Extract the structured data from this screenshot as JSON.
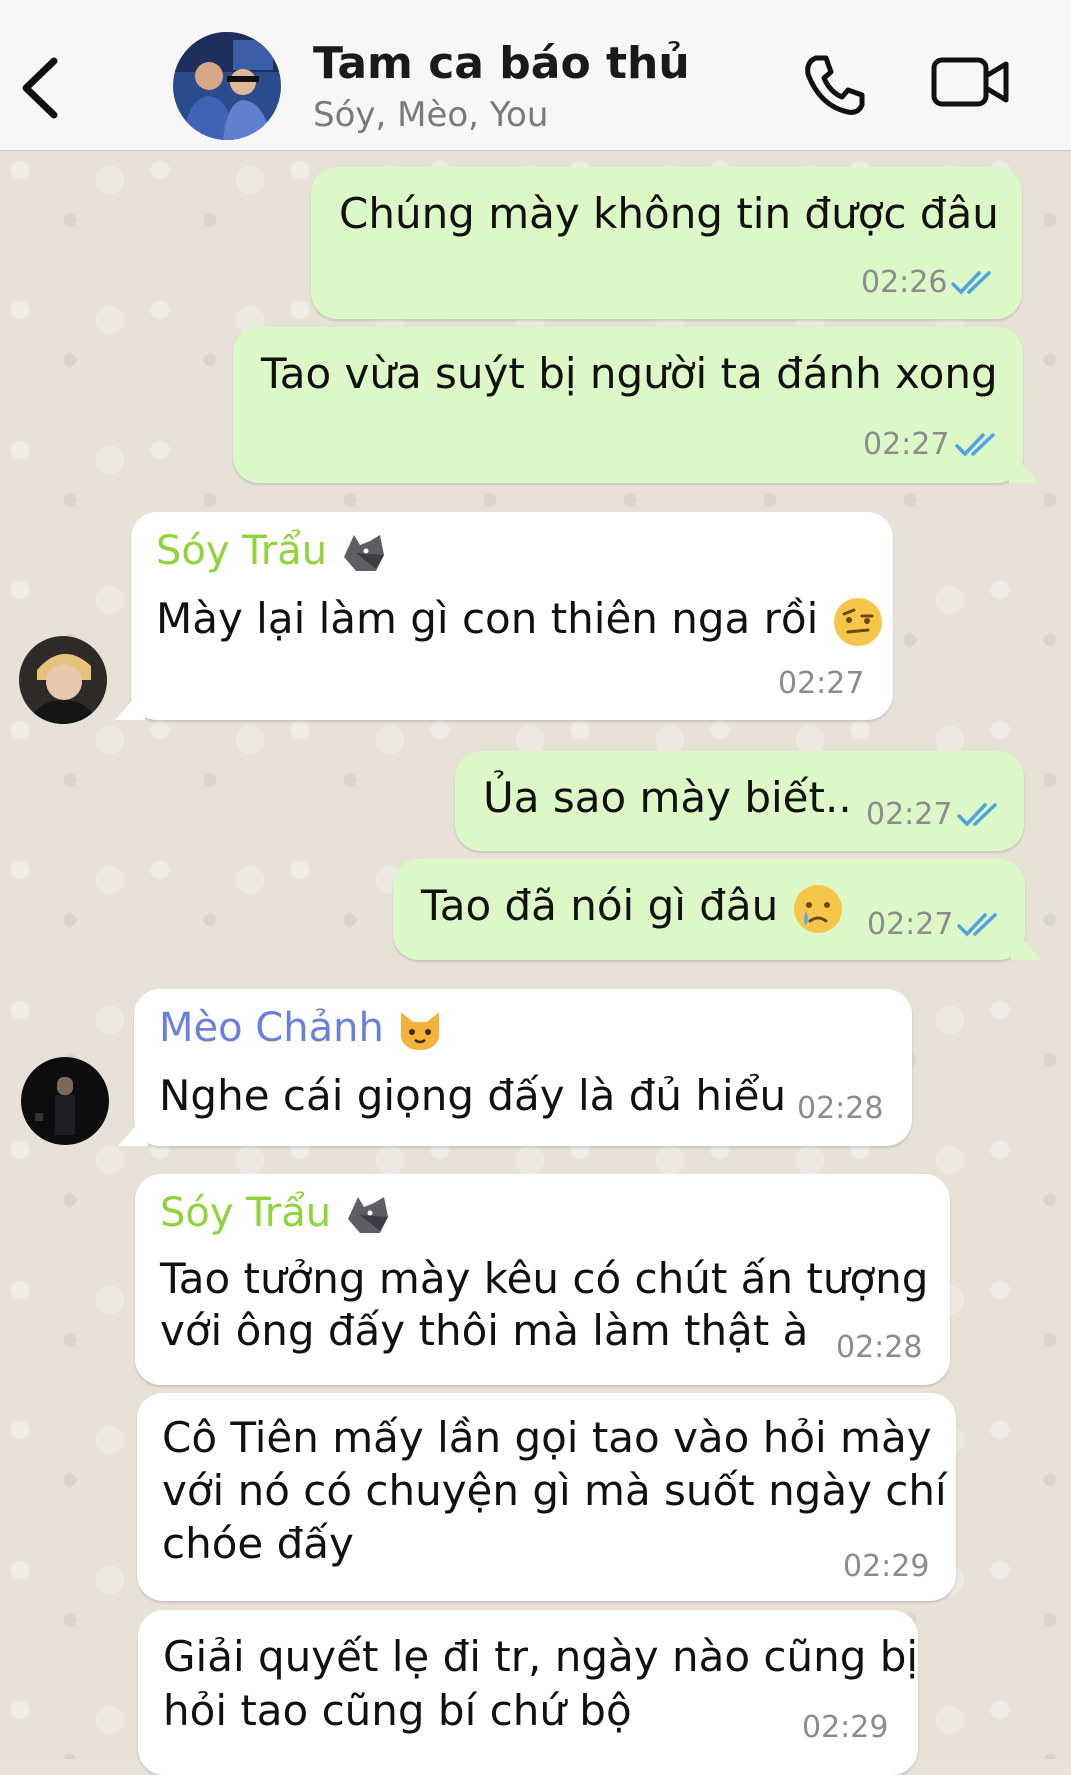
{
  "header": {
    "title": "Tam ca báo thủ",
    "subtitle": "Sóy, Mèo, You",
    "icons": {
      "back": "chevron-left-icon",
      "call": "phone-icon",
      "video": "video-camera-icon"
    }
  },
  "colors": {
    "outgoing_bubble": "#dcf8c6",
    "incoming_bubble": "#ffffff",
    "chat_background": "#e7e1d8",
    "read_ticks": "#4fa3e0",
    "sender_soy": "#8fd43b",
    "sender_meo": "#6b7fe0"
  },
  "messages": [
    {
      "direction": "out",
      "text": "Chúng mày không tin được đâu",
      "time": "02:26",
      "status": "read"
    },
    {
      "direction": "out",
      "text": "Tao vừa suýt bị người ta đánh xong",
      "time": "02:27",
      "status": "read"
    },
    {
      "direction": "in",
      "sender": "Sóy Trẩu",
      "sender_emoji": "wolf-emoji",
      "text": "Mày lại làm gì con thiên nga rồi",
      "text_emoji": "raised-eyebrow-face-emoji",
      "time": "02:27"
    },
    {
      "direction": "out",
      "text": "Ủa sao mày biết..",
      "time": "02:27",
      "status": "read"
    },
    {
      "direction": "out",
      "text": "Tao đã nói gì đâu",
      "text_emoji": "crying-face-emoji",
      "time": "02:27",
      "status": "read"
    },
    {
      "direction": "in",
      "sender": "Mèo Chảnh",
      "sender_emoji": "cat-face-emoji",
      "text": "Nghe cái giọng đấy là đủ hiểu",
      "time": "02:28"
    },
    {
      "direction": "in",
      "sender": "Sóy Trẩu",
      "sender_emoji": "wolf-emoji",
      "lines": [
        "Tao tưởng mày kêu có chút ấn tượng",
        "với ông đấy thôi mà làm thật à"
      ],
      "time": "02:28"
    },
    {
      "direction": "in",
      "lines": [
        "Cô Tiên mấy lần gọi tao vào hỏi mày",
        "với nó có chuyện gì mà suốt ngày chí",
        "chóe đấy"
      ],
      "time": "02:29"
    },
    {
      "direction": "in",
      "lines": [
        "Giải quyết lẹ đi tr, ngày nào cũng bị",
        "hỏi tao cũng bí chứ bộ"
      ],
      "time": "02:29"
    }
  ]
}
